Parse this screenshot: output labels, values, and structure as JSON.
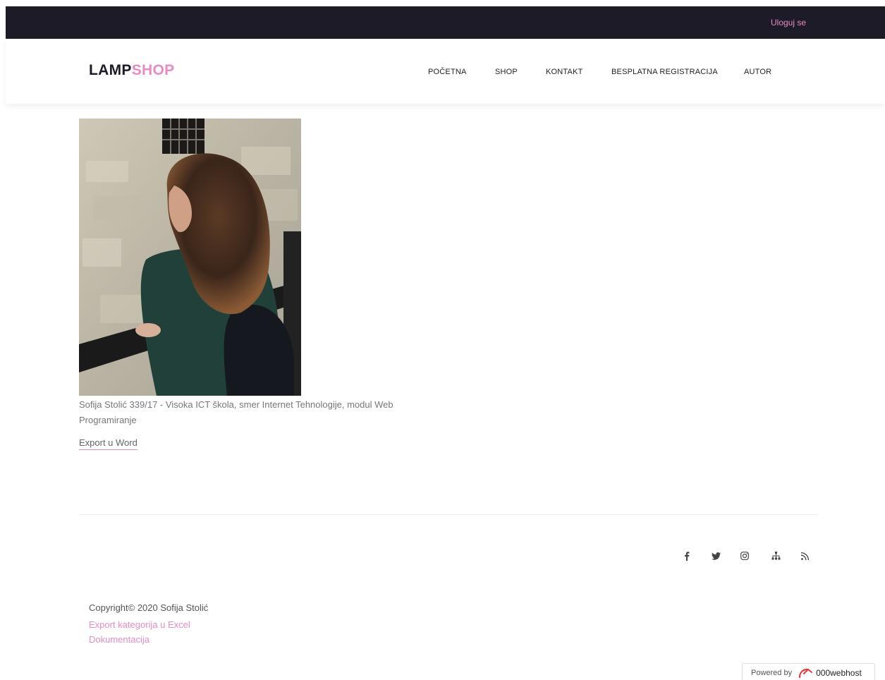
{
  "topbar": {
    "login_label": "Uloguj se"
  },
  "header": {
    "logo_part1": "LAMP",
    "logo_part2": "SHOP",
    "nav": [
      {
        "label": "POČETNA"
      },
      {
        "label": "SHOP"
      },
      {
        "label": "KONTAKT"
      },
      {
        "label": "BESPLATNA REGISTRACIJA"
      },
      {
        "label": "AUTOR"
      }
    ]
  },
  "main": {
    "caption": "Sofija Stolić 339/17 - Visoka ICT škola, smer Internet Tehnologije, modul Web Programiranje",
    "export_word_label": "Export u Word"
  },
  "footer": {
    "social_icons": [
      "facebook-icon",
      "twitter-icon",
      "instagram-icon",
      "sitemap-icon",
      "rss-icon"
    ],
    "copyright": "Copyright© 2020 Sofija Stolić",
    "export_excel_label": "Export kategorija u Excel",
    "docs_label": "Dokumentacija"
  },
  "powered": {
    "prefix": "Powered by",
    "brand": "000webhost"
  },
  "colors": {
    "accent": "#e58cc4",
    "dark": "#1e1b28"
  }
}
